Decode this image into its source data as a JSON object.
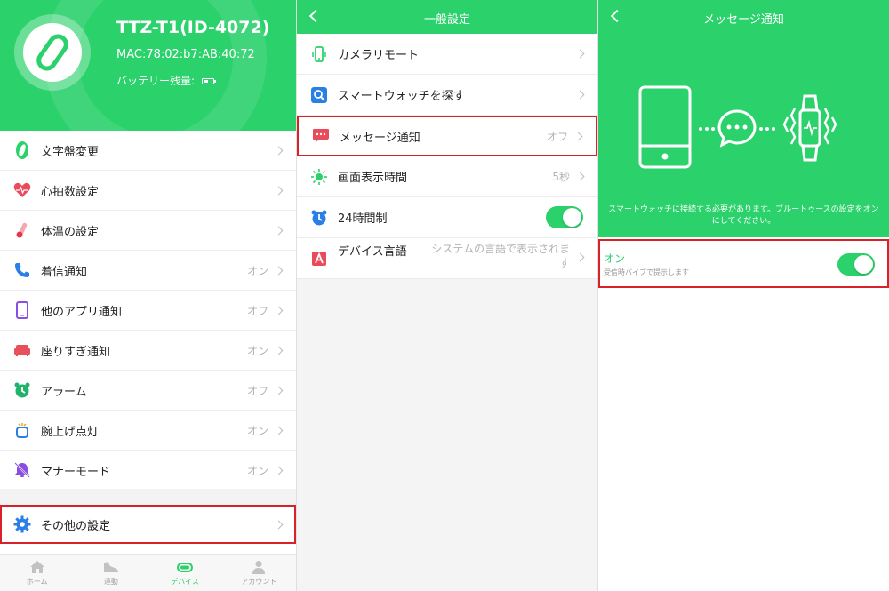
{
  "panel1": {
    "device_name": "TTZ-T1(ID-4072)",
    "mac": "MAC:78:02:b7:AB:40:72",
    "battery_label": "バッテリー残量:",
    "items": [
      {
        "label": "文字盤変更",
        "value": ""
      },
      {
        "label": "心拍数設定",
        "value": ""
      },
      {
        "label": "体温の設定",
        "value": ""
      },
      {
        "label": "着信通知",
        "value": "オン"
      },
      {
        "label": "他のアプリ通知",
        "value": "オフ"
      },
      {
        "label": "座りすぎ通知",
        "value": "オン"
      },
      {
        "label": "アラーム",
        "value": "オフ"
      },
      {
        "label": "腕上げ点灯",
        "value": "オン"
      },
      {
        "label": "マナーモード",
        "value": "オン"
      }
    ],
    "other_settings": "その他の設定",
    "tabs": [
      {
        "label": "ホーム"
      },
      {
        "label": "運動"
      },
      {
        "label": "デバイス"
      },
      {
        "label": "アカウント"
      }
    ]
  },
  "panel2": {
    "title": "一般設定",
    "items": [
      {
        "label": "カメラリモート",
        "value": ""
      },
      {
        "label": "スマートウォッチを探す",
        "value": ""
      },
      {
        "label": "メッセージ通知",
        "value": "オフ"
      },
      {
        "label": "画面表示時間",
        "value": "5秒"
      },
      {
        "label": "24時間制",
        "value": ""
      }
    ],
    "language_label": "デバイス言語",
    "language_value": "システムの言語で表示されます"
  },
  "panel3": {
    "title": "メッセージ通知",
    "description": "スマートウォッチに接続する必要があります。ブルートゥースの設定をオンにしてください。",
    "on_title": "オン",
    "on_subtitle": "受信時バイブで提示します"
  },
  "colors": {
    "accent": "#2bd16b",
    "highlight": "#d8222a"
  }
}
